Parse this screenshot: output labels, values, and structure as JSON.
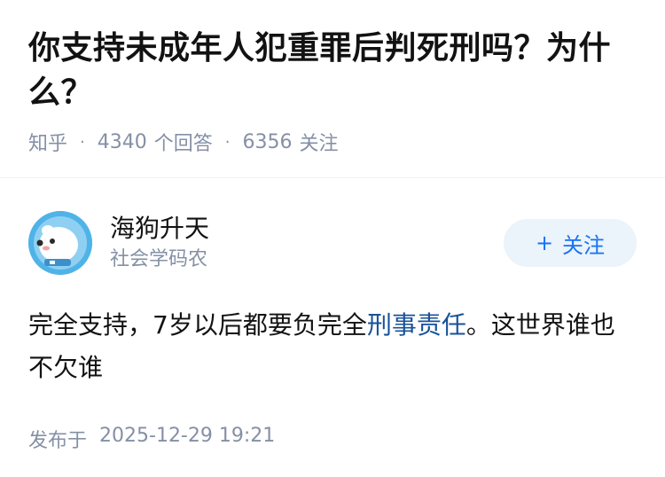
{
  "question": {
    "title": "你支持未成年人犯重罪后判死刑吗？为什么？",
    "source": "知乎",
    "answers_count": "4340",
    "answers_label": "个回答",
    "followers_count": "6356",
    "followers_label": "关注"
  },
  "answer": {
    "author_name": "海狗升天",
    "author_bio": "社会学码农",
    "follow_label": "关注",
    "follow_plus": "+",
    "content_before": "完全支持，7岁以后都要负完全",
    "content_link": "刑事责任",
    "content_after": "。这世界谁也不欠谁",
    "publish_label": "发布于",
    "publish_time": "2025-12-29 19:21"
  },
  "colors": {
    "link": "#175199",
    "follow_bg": "#ebf3fb",
    "follow_text": "#1772f6",
    "meta_gray": "#8590a6",
    "avatar_bg": "#4fb3e8"
  },
  "icons": {
    "avatar": "seal-cartoon-avatar"
  }
}
